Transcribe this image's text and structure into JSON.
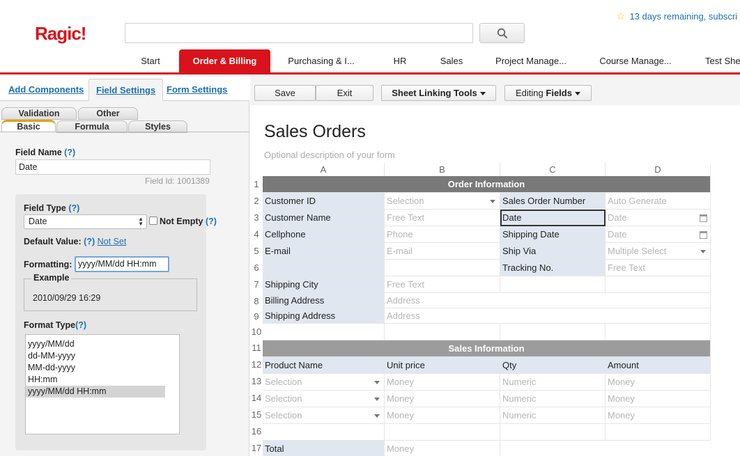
{
  "header": {
    "logo": "Ragic!",
    "trial": "13 days remaining, subscri",
    "search_placeholder": ""
  },
  "nav_tabs": [
    {
      "label": "Start"
    },
    {
      "label": "Order & Billing"
    },
    {
      "label": "Purchasing & I..."
    },
    {
      "label": "HR"
    },
    {
      "label": "Sales"
    },
    {
      "label": "Project Manage..."
    },
    {
      "label": "Course Manage..."
    },
    {
      "label": "Test She"
    }
  ],
  "left_tabs": [
    "Add Components",
    "Field Settings",
    "Form Settings"
  ],
  "sub_tabs": [
    "Validation",
    "Other",
    "Basic",
    "Formula",
    "Styles"
  ],
  "field_settings": {
    "field_name_label": "Field Name",
    "help": "(?)",
    "field_name_value": "Date",
    "field_id": "Field Id: 1001389",
    "field_type_label": "Field Type",
    "field_type_value": "Date",
    "not_empty_label": "Not Empty",
    "default_value_label": "Default Value:",
    "default_value_link": "Not Set",
    "formatting_label": "Formatting:",
    "formatting_value": "yyyy/MM/dd HH:mm",
    "example_label": "Example",
    "example_value": "2010/09/29 16:29",
    "format_type_label": "Format Type",
    "format_options": [
      "yyyy/MM/dd",
      "dd-MM-yyyy",
      "MM-dd-yyyy",
      "HH:mm",
      "yyyy/MM/dd HH:mm"
    ],
    "format_selected": 4
  },
  "toolbar": {
    "save": "Save",
    "exit": "Exit",
    "sheet_linking": "Sheet Linking Tools",
    "editing_prefix": "Editing ",
    "editing_bold": "Fields"
  },
  "form": {
    "title": "Sales Orders",
    "description": "Optional description of your form"
  },
  "sheet": {
    "columns": [
      "A",
      "B",
      "C",
      "D"
    ],
    "rows": [
      "1",
      "2",
      "3",
      "4",
      "5",
      "6",
      "7",
      "8",
      "9",
      "10",
      "11",
      "12",
      "13",
      "14",
      "15",
      "16",
      "17"
    ],
    "section_colors": {
      "order": "#797979",
      "sales": "#9c9c9c"
    },
    "cells": {
      "order_info": "Order Information",
      "customer_id": "Customer ID",
      "selection_b2": "Selection",
      "sales_order_number": "Sales Order Number",
      "auto_generate": "Auto Generate",
      "customer_name": "Customer Name",
      "free_text_b3": "Free Text",
      "date_label": "Date",
      "date_d3": "Date",
      "cellphone": "Cellphone",
      "phone": "Phone",
      "shipping_date": "Shipping Date",
      "date_d4": "Date",
      "email_label": "E-mail",
      "email_ph": "E-mail",
      "ship_via": "Ship Via",
      "multiple_select": "Multiple Select",
      "tracking_no": "Tracking No.",
      "free_text_d6": "Free Text",
      "shipping_city": "Shipping City",
      "free_text_b7": "Free Text",
      "billing_address": "Billing Address",
      "address_b8": "Address",
      "shipping_address": "Shipping Address",
      "address_b9": "Address",
      "sales_info": "Sales Information",
      "product_name": "Product Name",
      "unit_price": "Unit price",
      "qty": "Qty",
      "amount": "Amount",
      "selection": "Selection",
      "money": "Money",
      "numeric": "Numeric",
      "total": "Total"
    }
  }
}
